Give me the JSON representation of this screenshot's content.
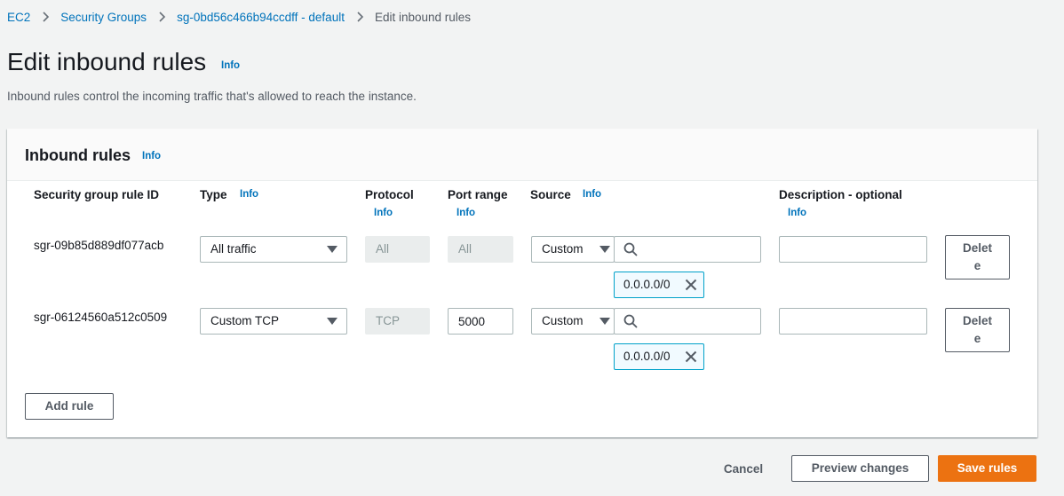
{
  "breadcrumb": {
    "items": [
      {
        "label": "EC2"
      },
      {
        "label": "Security Groups"
      },
      {
        "label": "sg-0bd56c466b94ccdff - default"
      }
    ],
    "current": "Edit inbound rules"
  },
  "header": {
    "title": "Edit inbound rules",
    "info": "Info",
    "description": "Inbound rules control the incoming traffic that's allowed to reach the instance."
  },
  "panel": {
    "title": "Inbound rules",
    "info": "Info",
    "columns": {
      "rule_id": "Security group rule ID",
      "type": "Type",
      "type_info": "Info",
      "protocol": "Protocol",
      "protocol_info": "Info",
      "port_range": "Port range",
      "port_range_info": "Info",
      "source": "Source",
      "source_info": "Info",
      "description": "Description - optional",
      "description_info": "Info"
    },
    "rules": [
      {
        "id": "sgr-09b85d889df077acb",
        "type": "All traffic",
        "protocol": "All",
        "port_range": "All",
        "port_editable": false,
        "source_type": "Custom",
        "source_search": "",
        "source_token": "0.0.0.0/0",
        "description": "",
        "delete_label": "Delete"
      },
      {
        "id": "sgr-06124560a512c0509",
        "type": "Custom TCP",
        "protocol": "TCP",
        "port_range": "5000",
        "port_editable": true,
        "source_type": "Custom",
        "source_search": "",
        "source_token": "0.0.0.0/0",
        "description": "",
        "delete_label": "Delete"
      }
    ],
    "add_rule": "Add rule"
  },
  "footer": {
    "cancel": "Cancel",
    "preview": "Preview changes",
    "save": "Save rules"
  },
  "icons": {
    "breadcrumb_separator": "chevron-right-icon",
    "dropdown": "caret-down-icon",
    "search": "search-icon",
    "remove_token": "close-icon"
  },
  "colors": {
    "link": "#0073bb",
    "primary": "#ec7211",
    "token_border": "#00a1c9",
    "token_bg": "#f1faff"
  }
}
